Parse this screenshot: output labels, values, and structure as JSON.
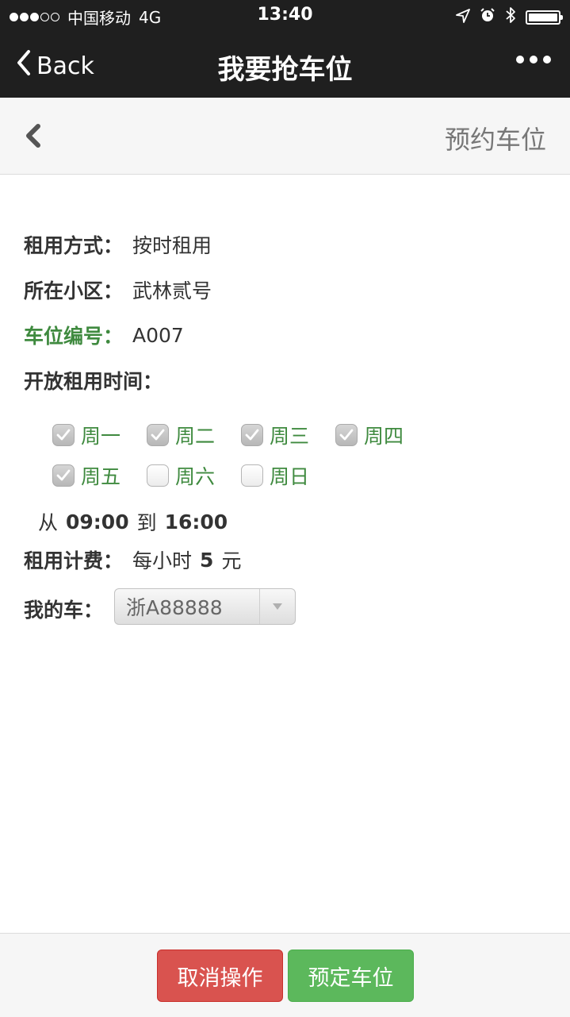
{
  "status_bar": {
    "carrier": "中国移动",
    "network": "4G",
    "time": "13:40",
    "signal_strength": 3,
    "signal_max": 5,
    "icons": [
      "location-icon",
      "alarm-icon",
      "bluetooth-icon",
      "battery-icon"
    ]
  },
  "nav": {
    "back_label": "Back",
    "title": "我要抢车位"
  },
  "subheader": {
    "title": "预约车位"
  },
  "form": {
    "rent_mode_label": "租用方式：",
    "rent_mode_value": "按时租用",
    "community_label": "所在小区：",
    "community_value": "武林贰号",
    "space_no_label": "车位编号：",
    "space_no_value": "A007",
    "open_time_label": "开放租用时间：",
    "days": [
      {
        "label": "周一",
        "checked": true
      },
      {
        "label": "周二",
        "checked": true
      },
      {
        "label": "周三",
        "checked": true
      },
      {
        "label": "周四",
        "checked": true
      },
      {
        "label": "周五",
        "checked": true
      },
      {
        "label": "周六",
        "checked": false
      },
      {
        "label": "周日",
        "checked": false
      }
    ],
    "time_from_prefix": "从",
    "time_from": "09:00",
    "time_to_prefix": "到",
    "time_to": "16:00",
    "fee_label": "租用计费：",
    "fee_prefix": "每小时",
    "fee_amount": "5",
    "fee_unit": "元",
    "my_car_label": "我的车：",
    "my_car_value": "浙A88888"
  },
  "footer": {
    "cancel_label": "取消操作",
    "reserve_label": "预定车位"
  },
  "colors": {
    "nav_bg": "#1f1f1f",
    "green_label": "#3f8a3f",
    "cancel_red": "#d9534f",
    "reserve_green": "#5cb85c"
  }
}
